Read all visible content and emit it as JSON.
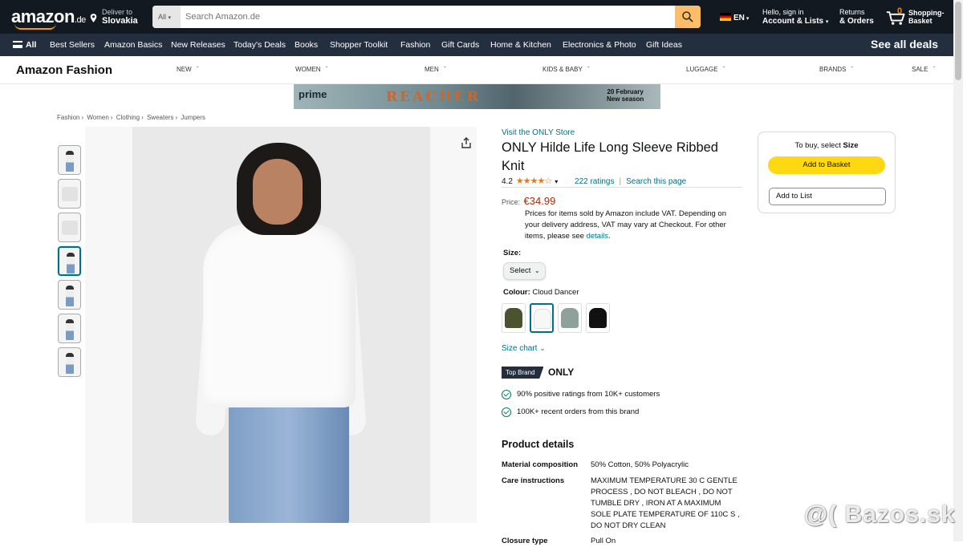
{
  "header": {
    "logo": "amazon",
    "logo_tld": ".de",
    "deliver_to_label": "Deliver to",
    "deliver_to_value": "Slovakia",
    "search_category": "All",
    "search_placeholder": "Search Amazon.de",
    "language": "EN",
    "account_line1": "Hello, sign in",
    "account_line2": "Account & Lists",
    "returns_line1": "Returns",
    "returns_line2": "& Orders",
    "basket_count": "0",
    "basket_line1": "Shopping-",
    "basket_line2": "Basket"
  },
  "nav": {
    "all": "All",
    "items": [
      "Best Sellers",
      "Amazon Basics",
      "New Releases",
      "Today's Deals",
      "Books",
      "Shopper Toolkit",
      "Fashion",
      "Gift Cards",
      "Home & Kitchen",
      "Electronics & Photo",
      "Gift Ideas"
    ],
    "see_all_deals": "See all deals"
  },
  "fashion_bar": {
    "brand": "Amazon Fashion",
    "categories": [
      "NEW",
      "WOMEN",
      "MEN",
      "KIDS & BABY",
      "LUGGAGE",
      "BRANDS",
      "SALE"
    ]
  },
  "banner": {
    "prime": "prime",
    "title": "REACHER",
    "date_line1": "20 February",
    "date_line2": "New season"
  },
  "breadcrumb": [
    "Fashion",
    "Women",
    "Clothing",
    "Sweaters",
    "Jumpers"
  ],
  "product": {
    "store_link": "Visit the ONLY Store",
    "title": "ONLY Hilde Life Long Sleeve Ribbed Knit",
    "rating": "4.2",
    "stars": "★★★★☆",
    "ratings_count": "222 ratings",
    "search_page": "Search this page",
    "price_label": "Price:",
    "price": "€34.99",
    "vat_text": "Prices for items sold by Amazon include VAT. Depending on your delivery address, VAT may vary at Checkout. For other items, please see",
    "vat_link": "details",
    "size_label": "Size:",
    "size_select": "Select",
    "colour_label": "Colour:",
    "colour_value": "Cloud Dancer",
    "size_chart": "Size chart",
    "top_brand_badge": "Top Brand",
    "brand_name": "ONLY",
    "brand_facts": [
      "90% positive ratings from 10K+ customers",
      "100K+ recent orders from this brand"
    ],
    "details_heading": "Product details",
    "details": [
      {
        "key": "Material composition",
        "value": "50% Cotton, 50% Polyacrylic"
      },
      {
        "key": "Care instructions",
        "value": "MAXIMUM TEMPERATURE 30 C GENTLE PROCESS , DO NOT BLEACH , DO NOT TUMBLE DRY , IRON AT A MAXIMUM SOLE PLATE TEMPERATURE OF 110C S , DO NOT DRY CLEAN"
      },
      {
        "key": "Closure type",
        "value": "Pull On"
      }
    ]
  },
  "buybox": {
    "hint_prefix": "To buy, select",
    "hint_strong": "Size",
    "add_to_basket": "Add to Basket",
    "add_to_list": "Add to List"
  },
  "colors": {
    "header_bg": "#131921",
    "nav_bg": "#232f3e",
    "accent": "#ff9900",
    "link": "#007185",
    "price": "#b12704",
    "buy_button": "#ffd814",
    "swatches": [
      "#4b5230",
      "#f7f7f7",
      "#8fa19a",
      "#111111"
    ]
  },
  "watermark": "@( Bazos.sk"
}
